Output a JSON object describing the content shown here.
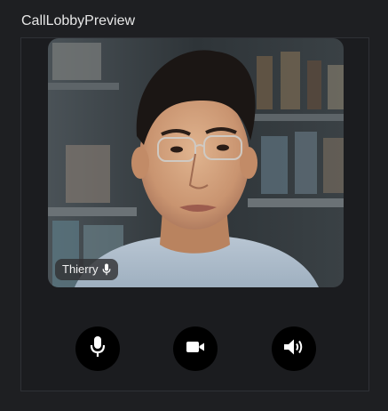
{
  "window": {
    "title": "CallLobbyPreview"
  },
  "participant": {
    "name": "Thierry",
    "status_icon": "microphone-icon"
  },
  "controls": {
    "microphone_icon": "microphone-icon",
    "camera_icon": "video-camera-icon",
    "speaker_icon": "speaker-volume-icon"
  },
  "colors": {
    "background": "#1e1f22",
    "panel_border": "#2f3136",
    "control_button": "#000000",
    "icon": "#ffffff"
  }
}
